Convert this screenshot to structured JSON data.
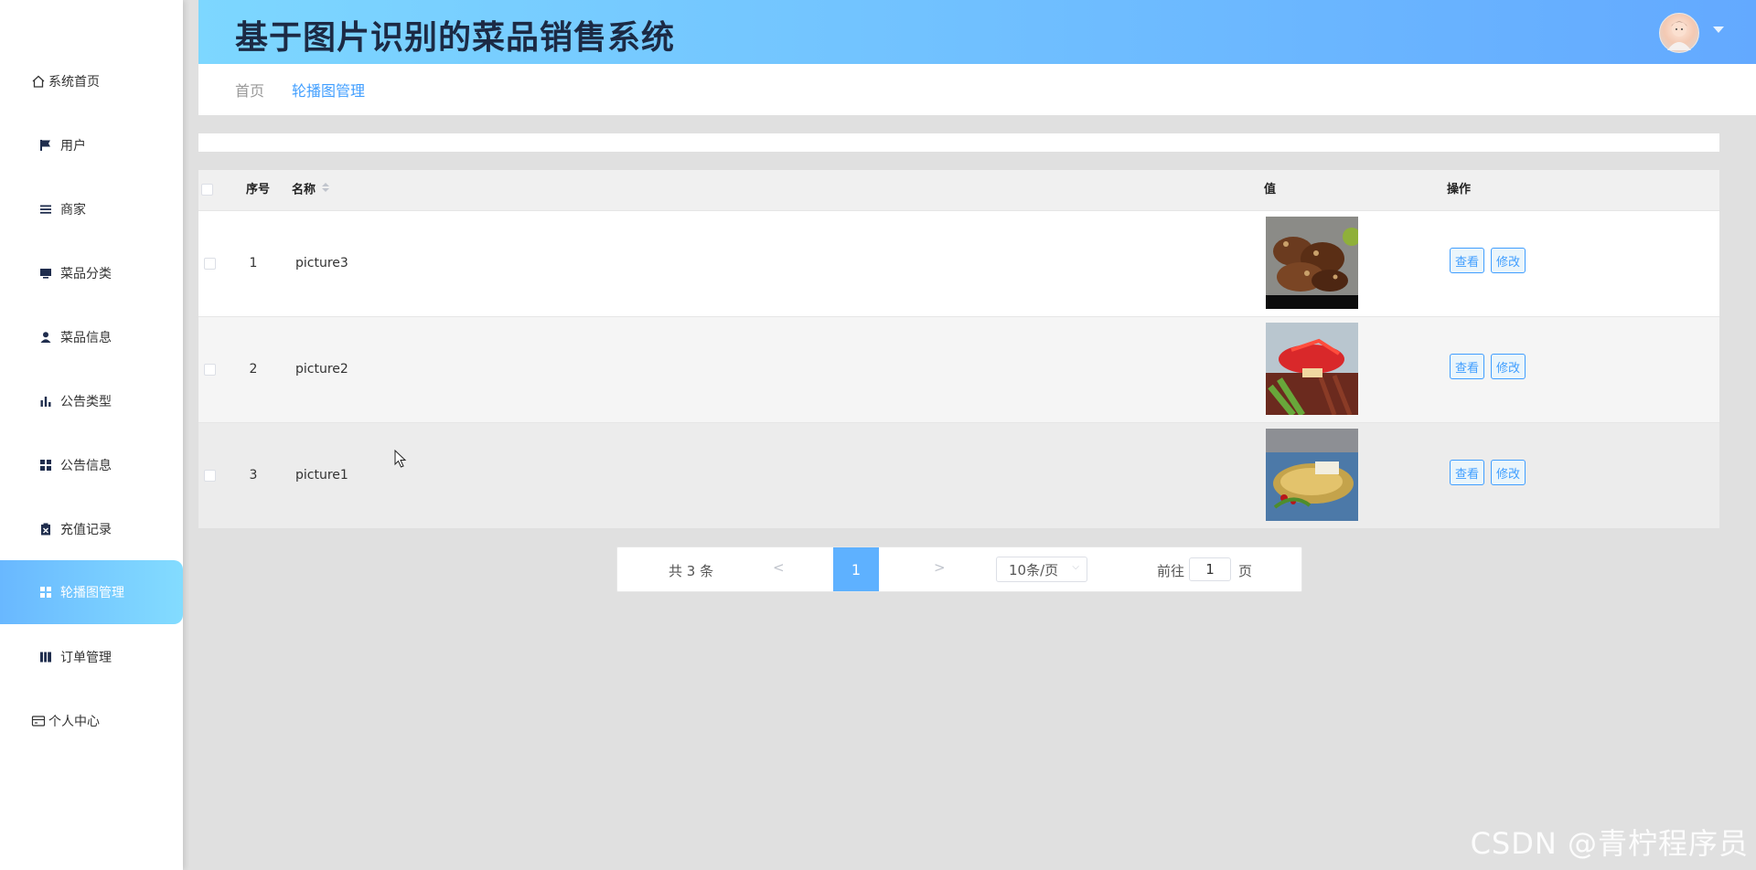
{
  "header": {
    "title": "基于图片识别的菜品销售系统"
  },
  "sidebar": {
    "items": [
      {
        "label": "系统首页",
        "icon": "home-icon"
      },
      {
        "label": "用户",
        "icon": "flag-icon"
      },
      {
        "label": "商家",
        "icon": "list-icon"
      },
      {
        "label": "菜品分类",
        "icon": "monitor-icon"
      },
      {
        "label": "菜品信息",
        "icon": "user-icon"
      },
      {
        "label": "公告类型",
        "icon": "bar-chart-icon"
      },
      {
        "label": "公告信息",
        "icon": "grid-icon"
      },
      {
        "label": "充值记录",
        "icon": "clipboard-icon"
      },
      {
        "label": "轮播图管理",
        "icon": "grid-icon",
        "active": true
      },
      {
        "label": "订单管理",
        "icon": "book-icon"
      },
      {
        "label": "个人中心",
        "icon": "card-icon"
      }
    ]
  },
  "breadcrumb": {
    "home": "首页",
    "current": "轮播图管理"
  },
  "table": {
    "headers": {
      "index": "序号",
      "name": "名称",
      "value": "值",
      "action": "操作"
    },
    "rows": [
      {
        "index": "1",
        "name": "picture3",
        "image": "grilled-meat-photo"
      },
      {
        "index": "2",
        "name": "picture2",
        "image": "salad-dish-photo"
      },
      {
        "index": "3",
        "name": "picture1",
        "image": "fried-fish-photo"
      }
    ],
    "view_label": "查看",
    "edit_label": "修改"
  },
  "pagination": {
    "total": "共 3 条",
    "prev": "<",
    "current_page": "1",
    "next": ">",
    "page_size": "10条/页",
    "goto_label": "前往",
    "goto_value": "1",
    "page_unit": "页"
  },
  "watermark": "CSDN @青柠程序员",
  "colors": {
    "accent": "#409eff",
    "header_start": "#7dd7ff",
    "header_end": "#63a9ff",
    "active_item": "#69b8ff"
  }
}
